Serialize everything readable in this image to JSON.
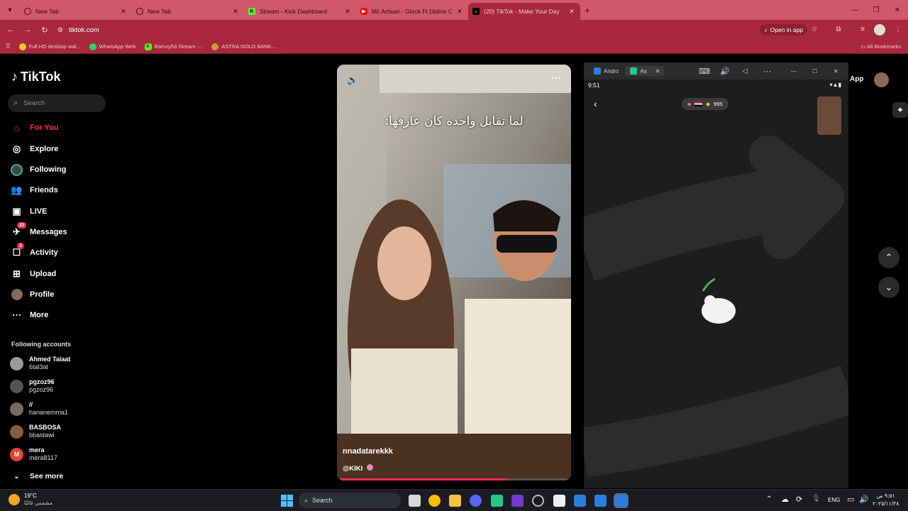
{
  "browser": {
    "tabs": [
      {
        "label": "New Tab",
        "icon": "globe-icon"
      },
      {
        "label": "New Tab",
        "icon": "globe-icon"
      },
      {
        "label": "Stream - Kick Dashboard",
        "icon": "kick-icon"
      },
      {
        "label": "Mc Artisan - Glock Ft Didine Ca",
        "icon": "youtube-icon"
      },
      {
        "label": "(20) TikTok - Make Your Day",
        "icon": "tiktok-icon"
      }
    ],
    "url": "tiktok.com",
    "open_in_app": "Open in app",
    "bookmarks": [
      {
        "label": "Full HD desktop wal...",
        "icon": "emoji-icon"
      },
      {
        "label": "WhatsApp Web",
        "icon": "whatsapp-icon"
      },
      {
        "label": "Ramzy53 Stream -...",
        "icon": "kick-icon"
      },
      {
        "label": "ASTRA GOLD BANK...",
        "icon": "bank-icon"
      }
    ],
    "all_bookmarks": "All Bookmarks"
  },
  "sidebar": {
    "logo": "TikTok",
    "search_placeholder": "Search",
    "nav": [
      {
        "label": "For You",
        "icon": "home-icon",
        "active": true
      },
      {
        "label": "Explore",
        "icon": "compass-icon"
      },
      {
        "label": "Following",
        "icon": "following-icon"
      },
      {
        "label": "Friends",
        "icon": "friends-icon"
      },
      {
        "label": "LIVE",
        "icon": "live-icon"
      },
      {
        "label": "Messages",
        "icon": "messages-icon",
        "badge": "23"
      },
      {
        "label": "Activity",
        "icon": "activity-icon",
        "badge": "3"
      },
      {
        "label": "Upload",
        "icon": "upload-icon"
      },
      {
        "label": "Profile",
        "icon": "profile-icon"
      },
      {
        "label": "More",
        "icon": "more-icon"
      }
    ],
    "following_title": "Following accounts",
    "accounts": [
      {
        "name": "Ahmed Talaat",
        "handle": "6tal3at"
      },
      {
        "name": "pgzoz96",
        "handle": "pgzoz96"
      },
      {
        "name": "//",
        "handle": "hananemma1"
      },
      {
        "name": "BASBOSA",
        "handle": "bbastawi"
      },
      {
        "name": "mera",
        "handle": "mera8117"
      }
    ],
    "see_more": "See more"
  },
  "video": {
    "caption": "لما تقابل واحدة كان عارفها:",
    "author": "nnadatarekkk",
    "mention": "@KIKI",
    "progress": 0.73
  },
  "phone_window": {
    "tabs": [
      "Andro",
      "As"
    ],
    "time": "9:51",
    "coins": "995",
    "right_label": "App"
  },
  "taskbar": {
    "temp": "19°C",
    "weather": "مشمس غالبًا",
    "search": "Search",
    "lang": "ENG",
    "time": "٩:٥١ ص",
    "date": "٢٠٢٥/١١/٢٨"
  },
  "colors": {
    "accent": "#fe2c55",
    "chrome": "#a8283e"
  }
}
